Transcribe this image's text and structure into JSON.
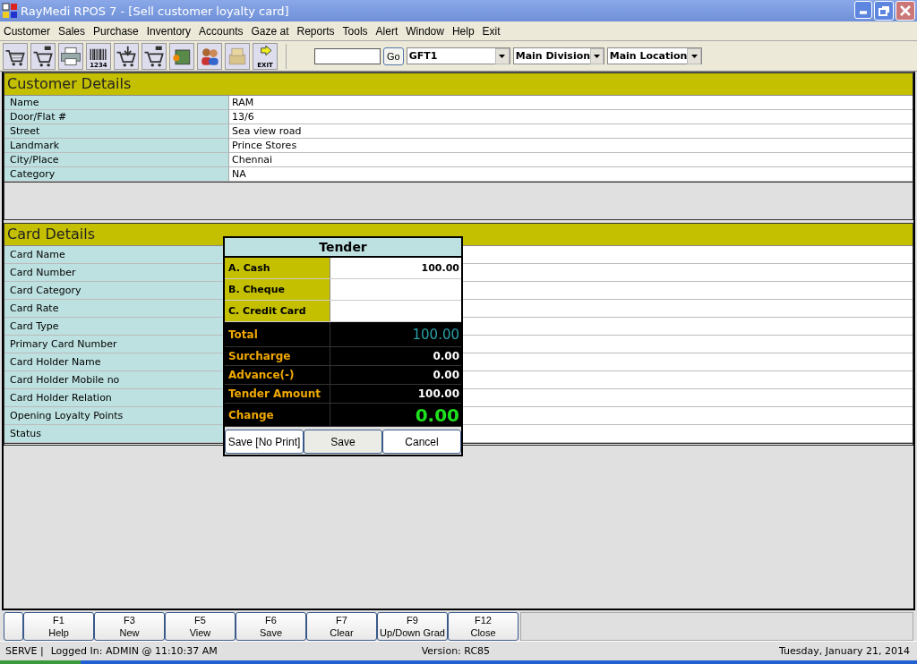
{
  "window": {
    "title": "RayMedi RPOS 7 - [Sell customer loyalty card]"
  },
  "menu": [
    "Customer",
    "Sales",
    "Purchase",
    "Inventory",
    "Accounts",
    "Gaze at",
    "Reports",
    "Tools",
    "Alert",
    "Window",
    "Help",
    "Exit"
  ],
  "toolbar": [
    {
      "kind": "cart"
    },
    {
      "kind": "cart-num"
    },
    {
      "kind": "printer"
    },
    {
      "kind": "barcode",
      "label": "1234"
    },
    {
      "kind": "cart-down"
    },
    {
      "kind": "cart-num"
    },
    {
      "kind": "box"
    },
    {
      "kind": "people"
    },
    {
      "kind": "stack"
    },
    {
      "kind": "exit",
      "label": "EXIT"
    }
  ],
  "search": {
    "button": "Go"
  },
  "selects": [
    "GFT1",
    "Main Division",
    "Main Location"
  ],
  "customer_details": {
    "title": "Customer Details",
    "rows": [
      {
        "label": "Name",
        "value": "RAM"
      },
      {
        "label": "Door/Flat #",
        "value": "13/6"
      },
      {
        "label": "Street",
        "value": "Sea view road"
      },
      {
        "label": "Landmark",
        "value": "Prince Stores"
      },
      {
        "label": "City/Place",
        "value": "Chennai"
      },
      {
        "label": "Category",
        "value": "NA"
      }
    ]
  },
  "card_details": {
    "title": "Card Details",
    "rows": [
      "Card Name",
      "Card Number",
      "Card Category",
      "Card Rate",
      "Card Type",
      "Primary Card Number",
      "Card Holder Name",
      "Card Holder Mobile no",
      "Card Holder Relation",
      "Opening Loyalty Points",
      "Status"
    ]
  },
  "tender": {
    "title": "Tender",
    "inputs": [
      {
        "label": "A. Cash",
        "value": "100.00"
      },
      {
        "label": "B. Cheque"
      },
      {
        "label": "C. Credit Card"
      }
    ],
    "totals": [
      {
        "label": "Total",
        "value": "100.00",
        "kind": "total"
      },
      {
        "label": "Surcharge",
        "value": "0.00",
        "kind": "plain"
      },
      {
        "label": "Advance(-)",
        "value": "0.00",
        "kind": "plain"
      },
      {
        "label": "Tender Amount",
        "value": "100.00",
        "kind": "plain"
      },
      {
        "label": "Change",
        "value": "0.00",
        "kind": "change"
      }
    ],
    "buttons": [
      "Save [No Print]",
      "Save",
      "Cancel"
    ]
  },
  "function_keys": [
    {
      "key": "F1",
      "label": "Help"
    },
    {
      "key": "F3",
      "label": "New"
    },
    {
      "key": "F5",
      "label": "View"
    },
    {
      "key": "F6",
      "label": "Save"
    },
    {
      "key": "F7",
      "label": "Clear"
    },
    {
      "key": "F9",
      "label": "Up/Down Grad"
    },
    {
      "key": "F12",
      "label": "Close"
    }
  ],
  "status_bar": {
    "mode": "SERVE |",
    "login": "Logged In: ADMIN  @ 11:10:37 AM",
    "version": "Version: RC85",
    "date": "Tuesday, January 21, 2014"
  }
}
